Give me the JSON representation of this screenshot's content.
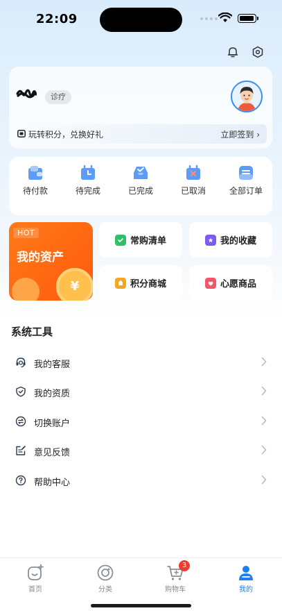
{
  "status_bar": {
    "time": "22:09"
  },
  "profile": {
    "tag": "诊疗",
    "points_text": "玩转积分，兑换好礼",
    "signin_label": "立即签到"
  },
  "orders": [
    {
      "label": "待付款",
      "icon": "wallet-icon"
    },
    {
      "label": "待完成",
      "icon": "clock-bag-icon"
    },
    {
      "label": "已完成",
      "icon": "inbox-check-icon"
    },
    {
      "label": "已取消",
      "icon": "cancel-bag-icon"
    },
    {
      "label": "全部订单",
      "icon": "all-orders-icon"
    }
  ],
  "assets": {
    "hot": "HOT",
    "title": "我的资产",
    "coin_symbol": "¥"
  },
  "features": [
    {
      "label": "常购清单",
      "icon": "list-check-icon",
      "color": "#2fbf6a"
    },
    {
      "label": "我的收藏",
      "icon": "star-shield-icon",
      "color": "#7a5cf5"
    },
    {
      "label": "积分商城",
      "icon": "points-mall-icon",
      "color": "#f5a623"
    },
    {
      "label": "心愿商品",
      "icon": "wish-bag-icon",
      "color": "#f2566b"
    }
  ],
  "tools": {
    "title": "系统工具",
    "items": [
      {
        "label": "我的客服",
        "icon": "customer-service-icon"
      },
      {
        "label": "我的资质",
        "icon": "shield-check-icon"
      },
      {
        "label": "切换账户",
        "icon": "switch-account-icon"
      },
      {
        "label": "意见反馈",
        "icon": "feedback-icon"
      },
      {
        "label": "帮助中心",
        "icon": "help-icon"
      }
    ]
  },
  "tabbar": {
    "items": [
      {
        "label": "首页",
        "icon": "home-icon"
      },
      {
        "label": "分类",
        "icon": "category-icon"
      },
      {
        "label": "购物车",
        "icon": "cart-icon",
        "badge": "3"
      },
      {
        "label": "我的",
        "icon": "profile-icon",
        "active": true
      }
    ]
  },
  "colors": {
    "accent": "#1e7ff0",
    "assets_bg": "#ff6a12",
    "badge": "#f23b2f"
  }
}
